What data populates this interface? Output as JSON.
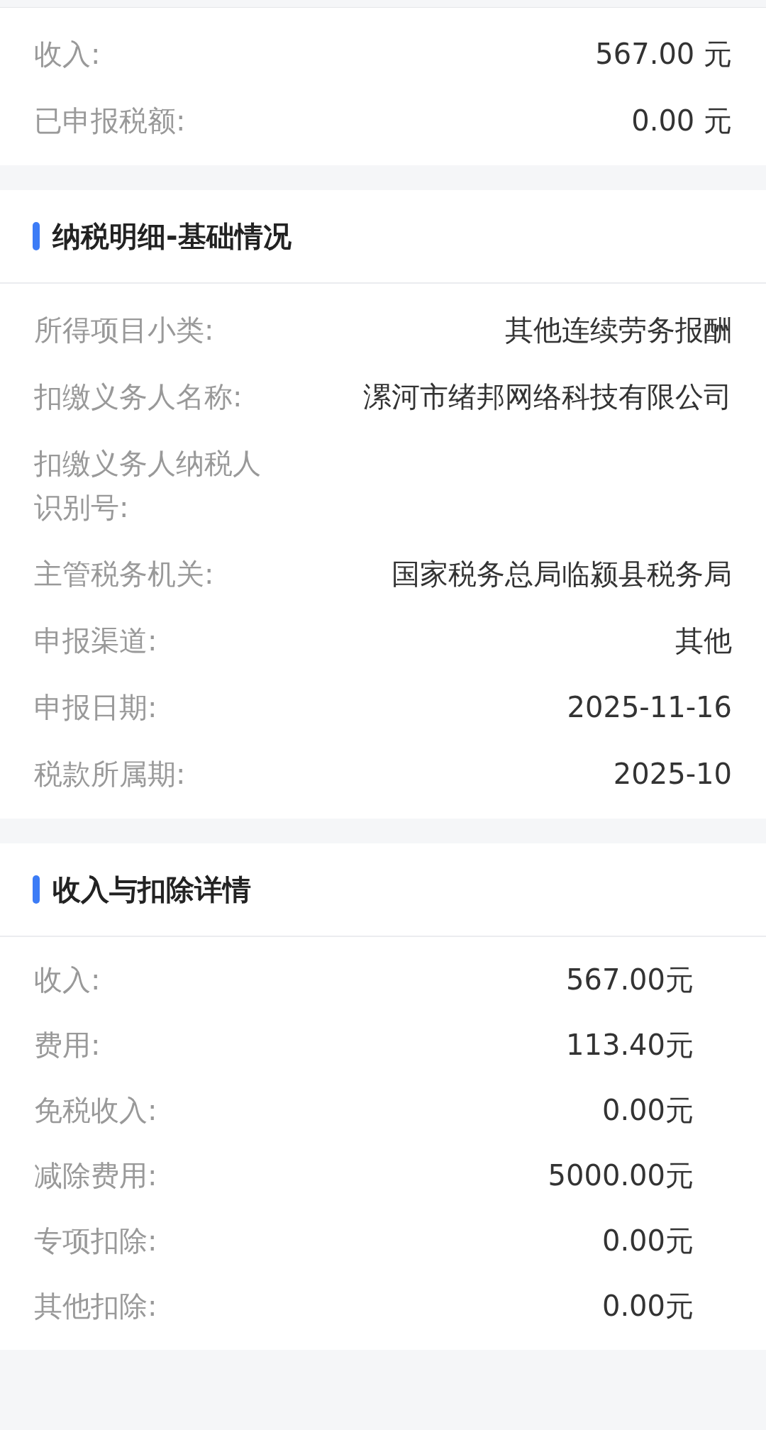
{
  "sections": [
    {
      "kind": "summary",
      "rows": [
        {
          "label": "收入:",
          "value": "567.00 元"
        },
        {
          "label": "已申报税额:",
          "value": "0.00 元"
        }
      ]
    },
    {
      "kind": "basic",
      "title": "纳税明细-基础情况",
      "rows": [
        {
          "label": "所得项目小类:",
          "value": "其他连续劳务报酬"
        },
        {
          "label": "扣缴义务人名称:",
          "value": "漯河市绪邦网络科技有限公司"
        },
        {
          "label": "扣缴义务人纳税人识别号:"
        },
        {
          "label": "主管税务机关:",
          "value": "国家税务总局临颍县税务局"
        },
        {
          "label": "申报渠道:",
          "value": "其他"
        },
        {
          "label": "申报日期:",
          "value": "2025-11-16"
        },
        {
          "label": "税款所属期:",
          "value": "2025-10"
        }
      ]
    },
    {
      "kind": "amounts",
      "title": "收入与扣除详情",
      "rows": [
        {
          "label": "收入:",
          "value": "567.00元"
        },
        {
          "label": "费用:",
          "value": "113.40元"
        },
        {
          "label": "免税收入:",
          "value": "0.00元"
        },
        {
          "label": "减除费用:",
          "value": "5000.00元"
        },
        {
          "label": "专项扣除:",
          "value": "0.00元"
        },
        {
          "label": "其他扣除:",
          "value": "0.00元"
        }
      ]
    }
  ]
}
